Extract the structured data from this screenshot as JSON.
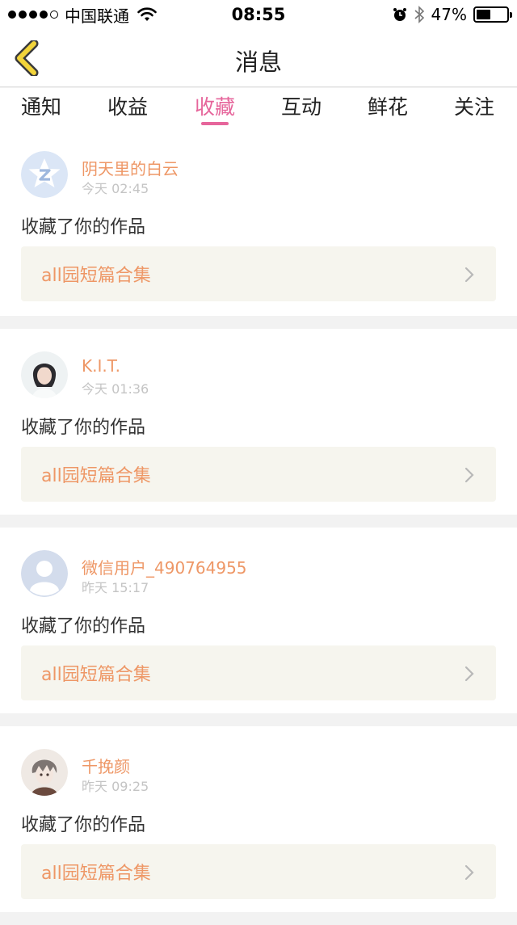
{
  "status_bar": {
    "carrier": "中国联通",
    "time": "08:55",
    "battery": "47%",
    "battery_level": 0.47
  },
  "nav": {
    "title": "消息"
  },
  "tabs": [
    {
      "label": "通知"
    },
    {
      "label": "收益"
    },
    {
      "label": "收藏"
    },
    {
      "label": "互动"
    },
    {
      "label": "鲜花"
    },
    {
      "label": "关注"
    }
  ],
  "active_tab": "收藏",
  "messages": [
    {
      "name": "阴天里的白云",
      "time": "今天 02:45",
      "action": "收藏了你的作品",
      "work": "all园短篇合集",
      "avatar": "qq-default-avatar"
    },
    {
      "name": "K.I.T.",
      "time": "今天 01:36",
      "action": "收藏了你的作品",
      "work": "all园短篇合集",
      "avatar": "photo-avatar"
    },
    {
      "name": "微信用户_490764955",
      "time": "昨天 15:17",
      "action": "收藏了你的作品",
      "work": "all园短篇合集",
      "avatar": "default-user-avatar"
    },
    {
      "name": "千挽颜",
      "time": "昨天 09:25",
      "action": "收藏了你的作品",
      "work": "all园短篇合集",
      "avatar": "anime-avatar"
    }
  ],
  "colors": {
    "accent": "#e6659b",
    "name": "#ee9766",
    "back_icon": "#f2d43a"
  }
}
